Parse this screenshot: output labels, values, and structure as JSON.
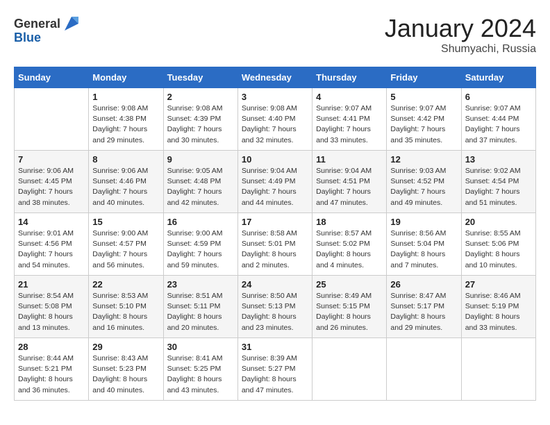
{
  "header": {
    "logo_general": "General",
    "logo_blue": "Blue",
    "month": "January 2024",
    "location": "Shumyachi, Russia"
  },
  "weekdays": [
    "Sunday",
    "Monday",
    "Tuesday",
    "Wednesday",
    "Thursday",
    "Friday",
    "Saturday"
  ],
  "weeks": [
    [
      {
        "day": "",
        "info": ""
      },
      {
        "day": "1",
        "info": "Sunrise: 9:08 AM\nSunset: 4:38 PM\nDaylight: 7 hours\nand 29 minutes."
      },
      {
        "day": "2",
        "info": "Sunrise: 9:08 AM\nSunset: 4:39 PM\nDaylight: 7 hours\nand 30 minutes."
      },
      {
        "day": "3",
        "info": "Sunrise: 9:08 AM\nSunset: 4:40 PM\nDaylight: 7 hours\nand 32 minutes."
      },
      {
        "day": "4",
        "info": "Sunrise: 9:07 AM\nSunset: 4:41 PM\nDaylight: 7 hours\nand 33 minutes."
      },
      {
        "day": "5",
        "info": "Sunrise: 9:07 AM\nSunset: 4:42 PM\nDaylight: 7 hours\nand 35 minutes."
      },
      {
        "day": "6",
        "info": "Sunrise: 9:07 AM\nSunset: 4:44 PM\nDaylight: 7 hours\nand 37 minutes."
      }
    ],
    [
      {
        "day": "7",
        "info": "Sunrise: 9:06 AM\nSunset: 4:45 PM\nDaylight: 7 hours\nand 38 minutes."
      },
      {
        "day": "8",
        "info": "Sunrise: 9:06 AM\nSunset: 4:46 PM\nDaylight: 7 hours\nand 40 minutes."
      },
      {
        "day": "9",
        "info": "Sunrise: 9:05 AM\nSunset: 4:48 PM\nDaylight: 7 hours\nand 42 minutes."
      },
      {
        "day": "10",
        "info": "Sunrise: 9:04 AM\nSunset: 4:49 PM\nDaylight: 7 hours\nand 44 minutes."
      },
      {
        "day": "11",
        "info": "Sunrise: 9:04 AM\nSunset: 4:51 PM\nDaylight: 7 hours\nand 47 minutes."
      },
      {
        "day": "12",
        "info": "Sunrise: 9:03 AM\nSunset: 4:52 PM\nDaylight: 7 hours\nand 49 minutes."
      },
      {
        "day": "13",
        "info": "Sunrise: 9:02 AM\nSunset: 4:54 PM\nDaylight: 7 hours\nand 51 minutes."
      }
    ],
    [
      {
        "day": "14",
        "info": "Sunrise: 9:01 AM\nSunset: 4:56 PM\nDaylight: 7 hours\nand 54 minutes."
      },
      {
        "day": "15",
        "info": "Sunrise: 9:00 AM\nSunset: 4:57 PM\nDaylight: 7 hours\nand 56 minutes."
      },
      {
        "day": "16",
        "info": "Sunrise: 9:00 AM\nSunset: 4:59 PM\nDaylight: 7 hours\nand 59 minutes."
      },
      {
        "day": "17",
        "info": "Sunrise: 8:58 AM\nSunset: 5:01 PM\nDaylight: 8 hours\nand 2 minutes."
      },
      {
        "day": "18",
        "info": "Sunrise: 8:57 AM\nSunset: 5:02 PM\nDaylight: 8 hours\nand 4 minutes."
      },
      {
        "day": "19",
        "info": "Sunrise: 8:56 AM\nSunset: 5:04 PM\nDaylight: 8 hours\nand 7 minutes."
      },
      {
        "day": "20",
        "info": "Sunrise: 8:55 AM\nSunset: 5:06 PM\nDaylight: 8 hours\nand 10 minutes."
      }
    ],
    [
      {
        "day": "21",
        "info": "Sunrise: 8:54 AM\nSunset: 5:08 PM\nDaylight: 8 hours\nand 13 minutes."
      },
      {
        "day": "22",
        "info": "Sunrise: 8:53 AM\nSunset: 5:10 PM\nDaylight: 8 hours\nand 16 minutes."
      },
      {
        "day": "23",
        "info": "Sunrise: 8:51 AM\nSunset: 5:11 PM\nDaylight: 8 hours\nand 20 minutes."
      },
      {
        "day": "24",
        "info": "Sunrise: 8:50 AM\nSunset: 5:13 PM\nDaylight: 8 hours\nand 23 minutes."
      },
      {
        "day": "25",
        "info": "Sunrise: 8:49 AM\nSunset: 5:15 PM\nDaylight: 8 hours\nand 26 minutes."
      },
      {
        "day": "26",
        "info": "Sunrise: 8:47 AM\nSunset: 5:17 PM\nDaylight: 8 hours\nand 29 minutes."
      },
      {
        "day": "27",
        "info": "Sunrise: 8:46 AM\nSunset: 5:19 PM\nDaylight: 8 hours\nand 33 minutes."
      }
    ],
    [
      {
        "day": "28",
        "info": "Sunrise: 8:44 AM\nSunset: 5:21 PM\nDaylight: 8 hours\nand 36 minutes."
      },
      {
        "day": "29",
        "info": "Sunrise: 8:43 AM\nSunset: 5:23 PM\nDaylight: 8 hours\nand 40 minutes."
      },
      {
        "day": "30",
        "info": "Sunrise: 8:41 AM\nSunset: 5:25 PM\nDaylight: 8 hours\nand 43 minutes."
      },
      {
        "day": "31",
        "info": "Sunrise: 8:39 AM\nSunset: 5:27 PM\nDaylight: 8 hours\nand 47 minutes."
      },
      {
        "day": "",
        "info": ""
      },
      {
        "day": "",
        "info": ""
      },
      {
        "day": "",
        "info": ""
      }
    ]
  ]
}
